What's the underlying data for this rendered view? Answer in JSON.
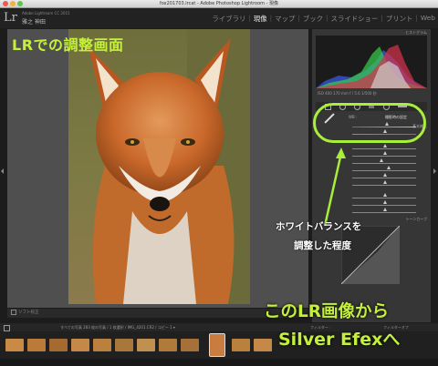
{
  "window": {
    "title": "fox201703.lrcat - Adobe Photoshop Lightroom - 現像"
  },
  "app": {
    "logo": "Lr",
    "product": "Adobe Lightroom CC 2015",
    "user": "雅之 神田"
  },
  "modules": [
    {
      "label": "ライブラリ",
      "active": false
    },
    {
      "label": "現像",
      "active": true
    },
    {
      "label": "マップ",
      "active": false
    },
    {
      "label": "ブック",
      "active": false
    },
    {
      "label": "スライドショー",
      "active": false
    },
    {
      "label": "プリント",
      "active": false
    },
    {
      "label": "Web",
      "active": false
    }
  ],
  "annotations": {
    "title": "LRでの調整画面",
    "wb_note_line1": "ホワイトバランスを",
    "wb_note_line2": "調整した程度",
    "export_line1": "このLR画像から",
    "export_line2": "Silver Efexへ"
  },
  "right_panel": {
    "histogram_label": "ヒストグラム",
    "readout": "ISO 400   170 mm   f / 5.6   1/500 秒",
    "basic_label": "基本補正",
    "wb_label": "WB :",
    "wb_preset": "撮影時の設定",
    "tone_curve_label": "トーンカーブ",
    "colors": {
      "hist_red": "#d8324a",
      "hist_green": "#38d04a",
      "hist_blue": "#3a58e0",
      "hist_gray": "#cfcfcf",
      "highlight": "#a8ee3a"
    }
  },
  "toolbar": {
    "soft_proof_label": "ソフト校正"
  },
  "filmstrip": {
    "info": "すべての写真   283 枚の写真 / 1 枚選択 / IMG_4201.CR2 / コピー 1 ▾",
    "filter_label": "フィルター :",
    "filter_value": "フィルターオフ"
  }
}
